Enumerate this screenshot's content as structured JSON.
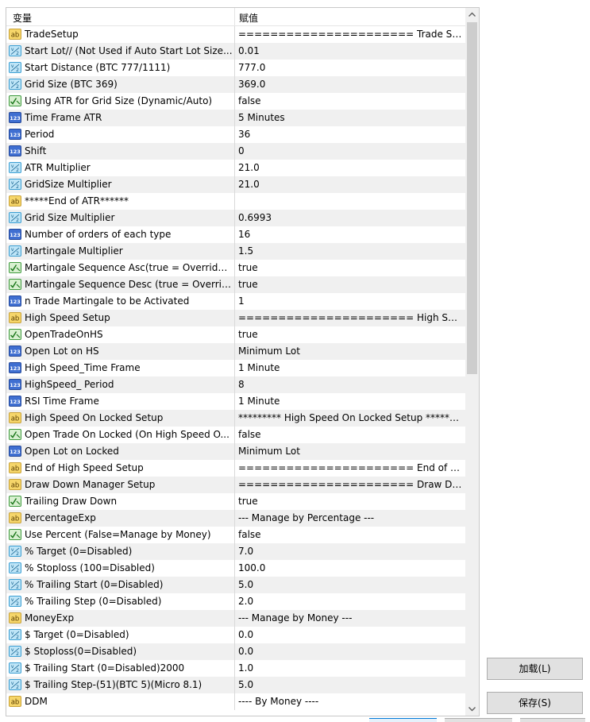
{
  "header": {
    "col_variable": "变量",
    "col_value": "赋值"
  },
  "rows": [
    {
      "icon": "ab",
      "name": "TradeSetup",
      "value": "====================== Trade Set..."
    },
    {
      "icon": "v2",
      "name": "Start Lot// (Not Used if Auto Start Lot Size...",
      "value": "0.01"
    },
    {
      "icon": "v2",
      "name": "Start Distance (BTC 777/1111)",
      "value": "777.0"
    },
    {
      "icon": "v2",
      "name": "Grid Size (BTC 369)",
      "value": "369.0"
    },
    {
      "icon": "bool",
      "name": "Using ATR for Grid Size (Dynamic/Auto)",
      "value": "false"
    },
    {
      "icon": "123",
      "name": "Time Frame ATR",
      "value": "5 Minutes"
    },
    {
      "icon": "123",
      "name": "Period",
      "value": "36"
    },
    {
      "icon": "123",
      "name": "Shift",
      "value": "0"
    },
    {
      "icon": "v2",
      "name": "ATR Multiplier",
      "value": "21.0"
    },
    {
      "icon": "v2",
      "name": "GridSize Multiplier",
      "value": "21.0"
    },
    {
      "icon": "ab",
      "name": "*****End of ATR******",
      "value": ""
    },
    {
      "icon": "v2",
      "name": "Grid Size Multiplier",
      "value": "0.6993"
    },
    {
      "icon": "123",
      "name": "Number of orders of each type",
      "value": "16"
    },
    {
      "icon": "v2",
      "name": "Martingale Multiplier",
      "value": "1.5"
    },
    {
      "icon": "bool",
      "name": "Martingale Sequence Asc(true = Override ...",
      "value": "true"
    },
    {
      "icon": "bool",
      "name": "Martingale Sequence Desc (true = Overrid...",
      "value": "true"
    },
    {
      "icon": "123",
      "name": "n Trade Martingale to be Activated",
      "value": "1"
    },
    {
      "icon": "ab",
      "name": "High Speed Setup",
      "value": "====================== High Spee..."
    },
    {
      "icon": "bool",
      "name": "OpenTradeOnHS",
      "value": "true"
    },
    {
      "icon": "123",
      "name": "Open Lot on HS",
      "value": "Minimum Lot"
    },
    {
      "icon": "123",
      "name": "High Speed_Time Frame",
      "value": "1 Minute"
    },
    {
      "icon": "123",
      "name": "HighSpeed_ Period",
      "value": "8"
    },
    {
      "icon": "123",
      "name": "RSI Time Frame",
      "value": "1 Minute"
    },
    {
      "icon": "ab",
      "name": "High Speed  On Locked  Setup",
      "value": "********* High Speed On Locked Setup *********"
    },
    {
      "icon": "bool",
      "name": "Open Trade On Locked (On High Speed O...",
      "value": "false"
    },
    {
      "icon": "123",
      "name": "Open Lot on Locked",
      "value": "Minimum Lot"
    },
    {
      "icon": "ab",
      "name": "End of High Speed Setup",
      "value": "====================== End of Hi..."
    },
    {
      "icon": "ab",
      "name": "Draw Down Manager  Setup",
      "value": "====================== Draw Dow..."
    },
    {
      "icon": "bool",
      "name": "Trailing Draw Down",
      "value": "true"
    },
    {
      "icon": "ab",
      "name": "PercentageExp",
      "value": "--- Manage by Percentage ---"
    },
    {
      "icon": "bool",
      "name": "Use Percent (False=Manage by Money)",
      "value": "false"
    },
    {
      "icon": "v2",
      "name": "% Target (0=Disabled)",
      "value": "7.0"
    },
    {
      "icon": "v2",
      "name": "% Stoploss (100=Disabled)",
      "value": "100.0"
    },
    {
      "icon": "v2",
      "name": "% Trailing Start (0=Disabled)",
      "value": "5.0"
    },
    {
      "icon": "v2",
      "name": "% Trailing Step (0=Disabled)",
      "value": "2.0"
    },
    {
      "icon": "ab",
      "name": "MoneyExp",
      "value": "--- Manage by Money ---"
    },
    {
      "icon": "v2",
      "name": "$ Target (0=Disabled)",
      "value": "0.0"
    },
    {
      "icon": "v2",
      "name": "$ Stoploss(0=Disabled)",
      "value": "0.0"
    },
    {
      "icon": "v2",
      "name": "$ Trailing Start (0=Disabled)2000",
      "value": "1.0"
    },
    {
      "icon": "v2",
      "name": "$ Trailing Step-(51)(BTC 5)(Micro 8.1)",
      "value": "5.0"
    },
    {
      "icon": "ab",
      "name": "DDM",
      "value": "---- By Money ----"
    }
  ],
  "buttons": {
    "load": "加载(L)",
    "save": "保存(S)"
  }
}
